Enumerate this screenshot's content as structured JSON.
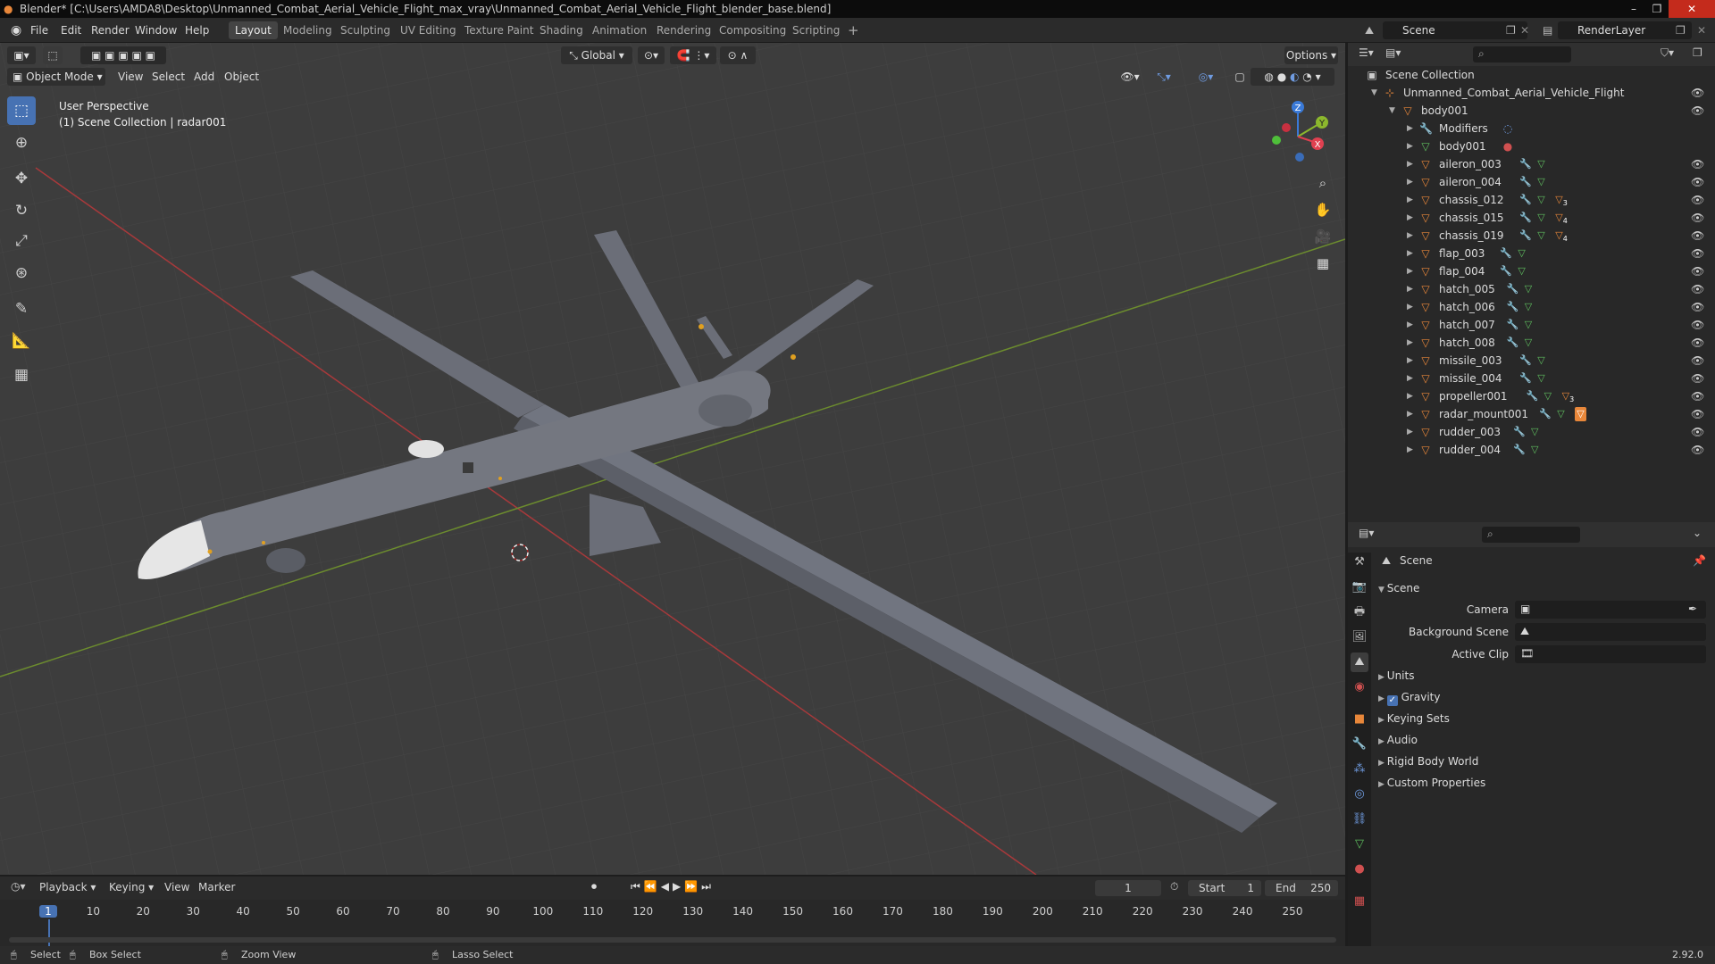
{
  "window": {
    "title": "Blender* [C:\\Users\\AMDA8\\Desktop\\Unmanned_Combat_Aerial_Vehicle_Flight_max_vray\\Unmanned_Combat_Aerial_Vehicle_Flight_blender_base.blend]"
  },
  "menu": {
    "items": [
      "File",
      "Edit",
      "Render",
      "Window",
      "Help"
    ]
  },
  "workspaces": {
    "tabs": [
      "Layout",
      "Modeling",
      "Sculpting",
      "UV Editing",
      "Texture Paint",
      "Shading",
      "Animation",
      "Rendering",
      "Compositing",
      "Scripting"
    ],
    "active": "Layout",
    "add": "+"
  },
  "scene_selector": {
    "value": "Scene"
  },
  "layer_selector": {
    "value": "RenderLayer"
  },
  "viewport": {
    "transform_orientation": "Global",
    "options_label": "Options",
    "mode": "Object Mode",
    "header_menu": [
      "View",
      "Select",
      "Add",
      "Object"
    ],
    "info_line1": "User Perspective",
    "info_line2": "(1) Scene Collection | radar001",
    "gizmo_axes": {
      "z": "Z",
      "y": "Y",
      "x": "X"
    }
  },
  "outliner": {
    "root": "Scene Collection",
    "collection": "Unmanned_Combat_Aerial_Vehicle_Flight",
    "parent": "body001",
    "children_meta": [
      "Modifiers",
      "body001"
    ],
    "objects": [
      "aileron_003",
      "aileron_004",
      "chassis_012",
      "chassis_015",
      "chassis_019",
      "flap_003",
      "flap_004",
      "hatch_005",
      "hatch_006",
      "hatch_007",
      "hatch_008",
      "missile_003",
      "missile_004",
      "propeller001",
      "radar_mount001",
      "rudder_003",
      "rudder_004"
    ],
    "child_counts": {
      "chassis_012": "3",
      "chassis_015": "4",
      "chassis_019": "4",
      "propeller001": "3"
    }
  },
  "properties": {
    "header": "Scene",
    "panel": "Scene",
    "fields": {
      "camera": "Camera",
      "background_scene": "Background Scene",
      "active_clip": "Active Clip"
    },
    "sections": [
      "Units",
      "Gravity",
      "Keying Sets",
      "Audio",
      "Rigid Body World",
      "Custom Properties"
    ],
    "gravity_checked": true
  },
  "timeline": {
    "menu": [
      "Playback",
      "Keying",
      "View",
      "Marker"
    ],
    "current_frame": "1",
    "start_label": "Start",
    "start": "1",
    "end_label": "End",
    "end": "250",
    "ticks": [
      "1",
      "10",
      "20",
      "30",
      "40",
      "50",
      "60",
      "70",
      "80",
      "90",
      "100",
      "110",
      "120",
      "130",
      "140",
      "150",
      "160",
      "170",
      "180",
      "190",
      "200",
      "210",
      "220",
      "230",
      "240",
      "250"
    ]
  },
  "statusbar": {
    "select": "Select",
    "box_select": "Box Select",
    "zoom_view": "Zoom View",
    "lasso_select": "Lasso Select",
    "version": "2.92.0"
  },
  "colors": {
    "accent": "#4772b3",
    "x_axis": "#a8393b",
    "y_axis": "#6c8c2e",
    "mesh_orange": "#e8873a",
    "data_green": "#5fbf5f",
    "wrench_blue": "#6f9be0"
  }
}
